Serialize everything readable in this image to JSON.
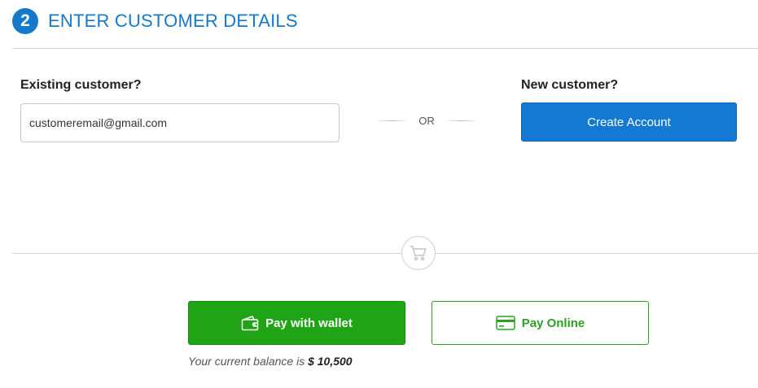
{
  "header": {
    "step_number": "2",
    "title": "ENTER CUSTOMER DETAILS"
  },
  "existing": {
    "label": "Existing customer?",
    "email_value": "customeremail@gmail.com"
  },
  "divider": {
    "or_text": "OR"
  },
  "new_customer": {
    "label": "New customer?",
    "create_label": "Create Account"
  },
  "payment": {
    "wallet_label": "Pay with wallet",
    "online_label": "Pay Online",
    "balance_prefix": "Your current balance is",
    "balance_amount": "$ 10,500"
  },
  "icons": {
    "cart": "cart-icon",
    "wallet": "wallet-icon",
    "card": "credit-card-icon"
  },
  "colors": {
    "accent": "#1479c9",
    "create_button": "#1479d2",
    "wallet_green": "#1ea414",
    "online_green": "#2aa321"
  }
}
